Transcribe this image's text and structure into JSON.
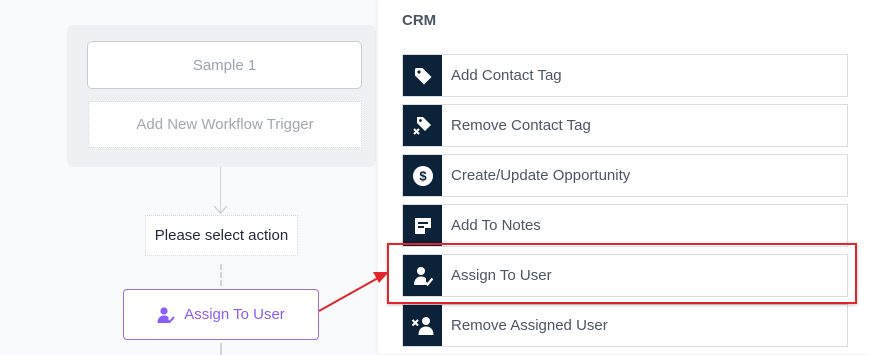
{
  "canvas": {
    "trigger_node": "Sample 1",
    "add_trigger": "Add New Workflow Trigger",
    "select_action": "Please select action",
    "assign_node": {
      "label": "Assign To User",
      "icon": "user-check-icon",
      "color": "#8b5cf6"
    }
  },
  "panel": {
    "section_title": "CRM",
    "icon_bg_color": "#0b2239",
    "items": [
      {
        "label": "Add Contact Tag",
        "icon": "tag-icon"
      },
      {
        "label": "Remove Contact Tag",
        "icon": "tag-remove-icon"
      },
      {
        "label": "Create/Update Opportunity",
        "icon": "dollar-icon"
      },
      {
        "label": "Add To Notes",
        "icon": "note-icon"
      },
      {
        "label": "Assign To User",
        "icon": "user-check-icon"
      },
      {
        "label": "Remove Assigned User",
        "icon": "user-remove-icon"
      }
    ]
  },
  "annotation": {
    "color": "#e0262b"
  }
}
